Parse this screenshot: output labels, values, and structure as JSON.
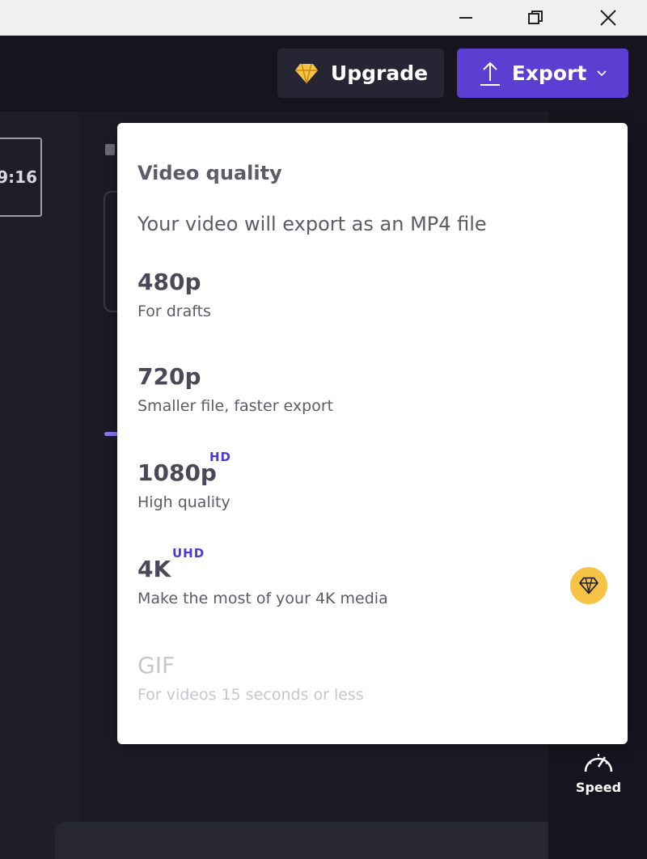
{
  "window": {
    "minimize_icon": "minimize-icon",
    "restore_icon": "restore-icon",
    "close_icon": "close-icon"
  },
  "header": {
    "upgrade_label": "Upgrade",
    "export_label": "Export",
    "upgrade_color": "#f7c347",
    "export_color": "#5b3fd3"
  },
  "canvas": {
    "aspect_ratio": "9:16",
    "speed_label": "Speed"
  },
  "export_menu": {
    "title": "Video quality",
    "subtitle": "Your video will export as an MP4 file",
    "options": [
      {
        "name": "480p",
        "badge": "",
        "description": "For drafts",
        "premium": false,
        "disabled": false
      },
      {
        "name": "720p",
        "badge": "",
        "description": "Smaller file, faster export",
        "premium": false,
        "disabled": false
      },
      {
        "name": "1080p",
        "badge": "HD",
        "description": "High quality",
        "premium": false,
        "disabled": false
      },
      {
        "name": "4K",
        "badge": "UHD",
        "description": "Make the most of your 4K media",
        "premium": true,
        "disabled": false
      },
      {
        "name": "GIF",
        "badge": "",
        "description": "For videos 15 seconds or less",
        "premium": false,
        "disabled": true
      }
    ]
  }
}
